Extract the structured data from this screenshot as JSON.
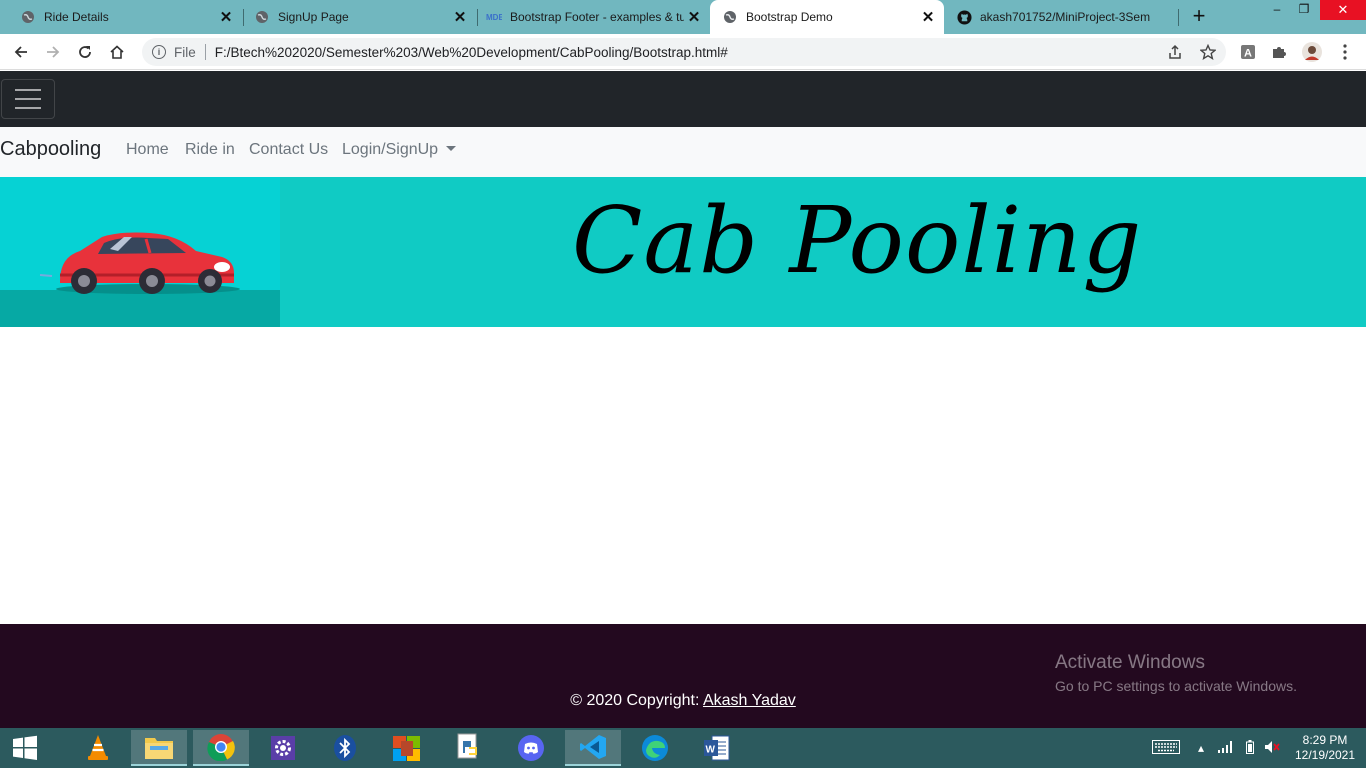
{
  "browser": {
    "tabs": [
      {
        "title": "Ride Details",
        "icon": "globe-icon"
      },
      {
        "title": "SignUp Page",
        "icon": "globe-icon"
      },
      {
        "title": "Bootstrap Footer - examples & tutorial",
        "icon": "mdb-icon"
      },
      {
        "title": "Bootstrap Demo",
        "icon": "globe-icon",
        "active": true
      },
      {
        "title": "akash701752/MiniProject-3Sem",
        "icon": "github-icon"
      }
    ],
    "new_tab": "+",
    "window_controls": {
      "minimize": "–",
      "restore": "❐",
      "close": "✕"
    },
    "address": {
      "scheme": "File",
      "url": "F:/Btech%202020/Semester%203/Web%20Development/CabPooling/Bootstrap.html#"
    }
  },
  "page": {
    "navbar": {
      "brand": "Cabpooling",
      "links": [
        "Home",
        "Ride in",
        "Contact Us",
        "Login/SignUp"
      ]
    },
    "banner": {
      "title": "Cab Pooling"
    },
    "footer": {
      "copyright_prefix": "© 2020 Copyright: ",
      "author": "Akash Yadav"
    }
  },
  "watermark": {
    "title": "Activate Windows",
    "subtitle": "Go to PC settings to activate Windows."
  },
  "taskbar": {
    "apps": [
      "windows-start-icon",
      "vlc-icon",
      "file-explorer-icon",
      "chrome-icon",
      "settings-icon",
      "bluetooth-icon",
      "office-icon",
      "python-icon",
      "discord-icon",
      "vscode-icon",
      "edge-icon",
      "word-icon"
    ],
    "clock": {
      "time": "8:29 PM",
      "date": "12/19/2021"
    }
  },
  "colors": {
    "tabstrip": "#71b7bf",
    "navbar_dark": "#212529",
    "banner": "#10cbc4",
    "footer": "#23091f",
    "taskbar": "#2c5a5e"
  }
}
